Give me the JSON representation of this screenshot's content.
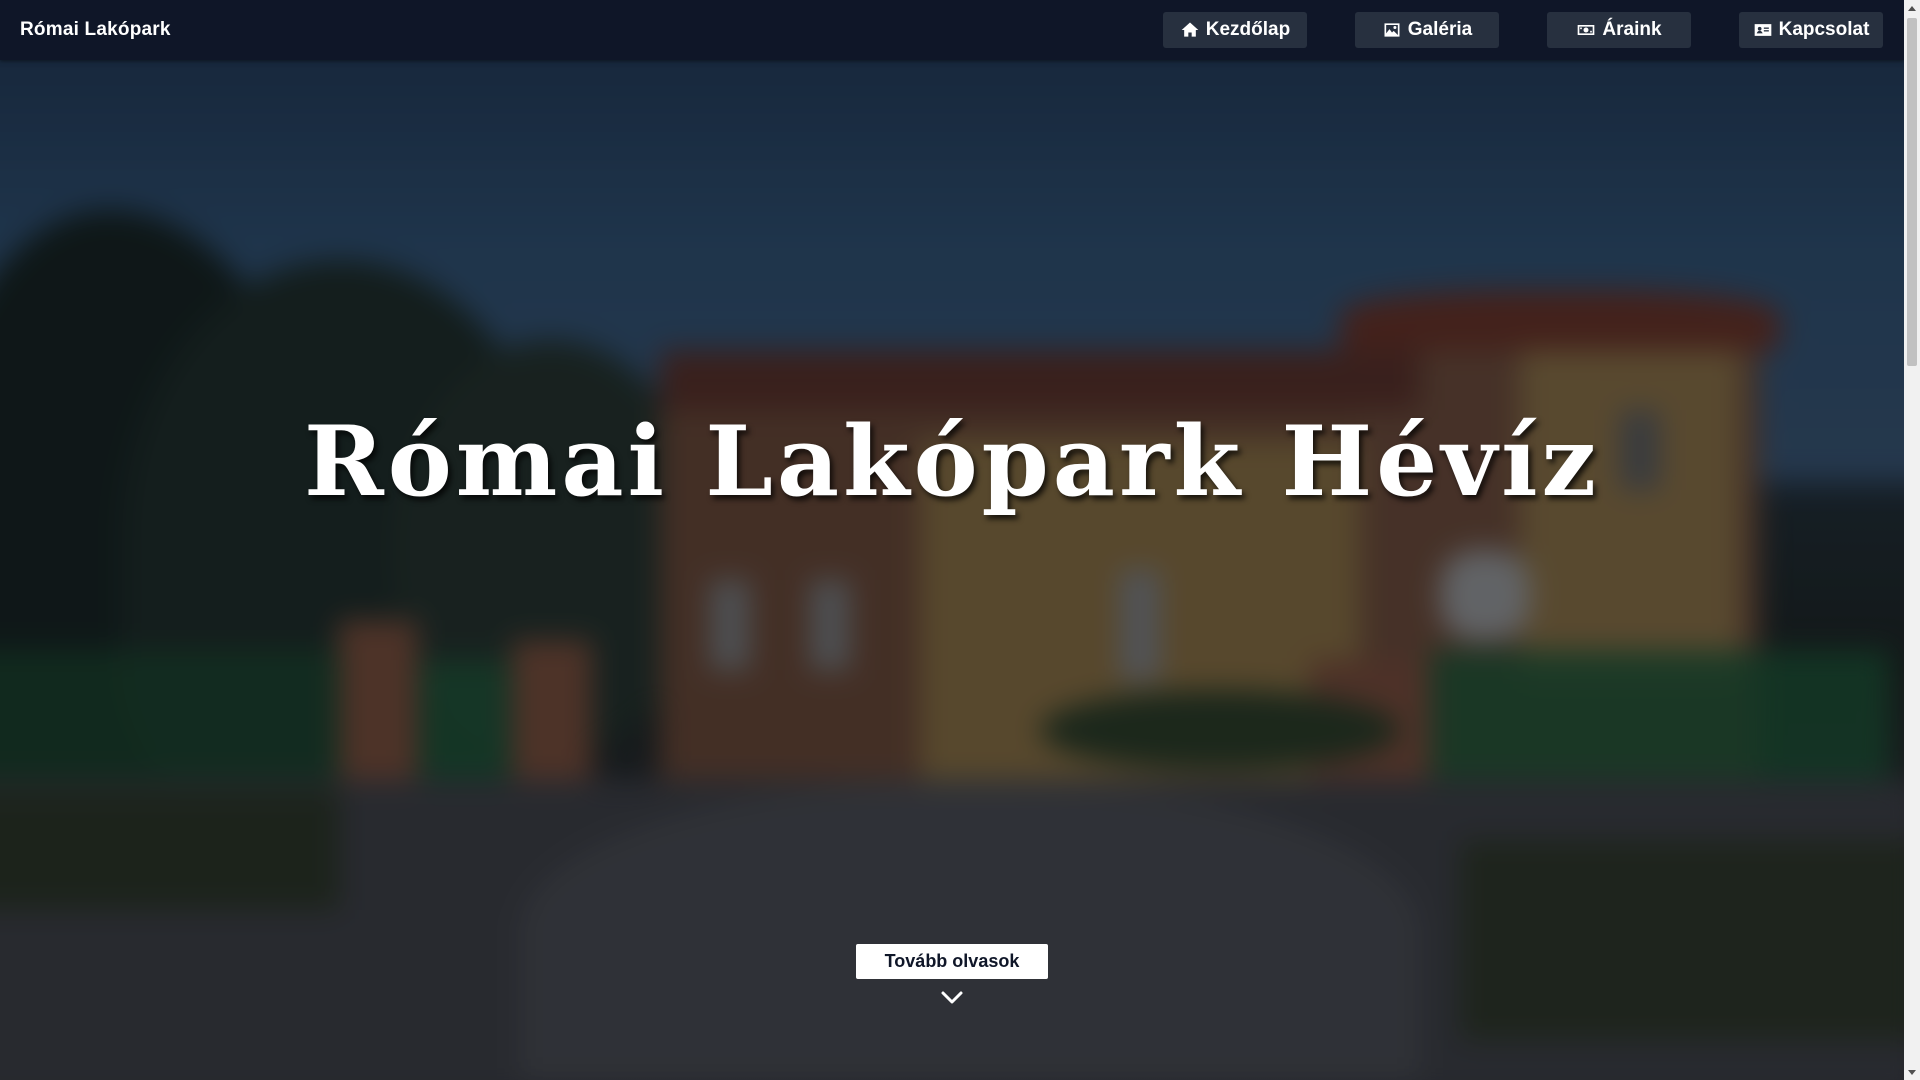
{
  "navbar": {
    "brand": "Római Lakópark",
    "items": [
      {
        "label": "Kezdőlap",
        "icon": "home-icon"
      },
      {
        "label": "Galéria",
        "icon": "image-icon"
      },
      {
        "label": "Áraink",
        "icon": "money-icon"
      },
      {
        "label": "Kapcsolat",
        "icon": "contact-card-icon"
      }
    ]
  },
  "hero": {
    "title": "Római Lakópark Hévíz",
    "cta_label": "Tovább olvasok",
    "scroll_icon": "chevron-down-icon"
  },
  "colors": {
    "navbar_bg": "#0f1628",
    "nav_button_bg": "#27303f",
    "cta_bg": "#ffffff",
    "cta_text": "#0f1628",
    "title_text": "#ffffff"
  }
}
